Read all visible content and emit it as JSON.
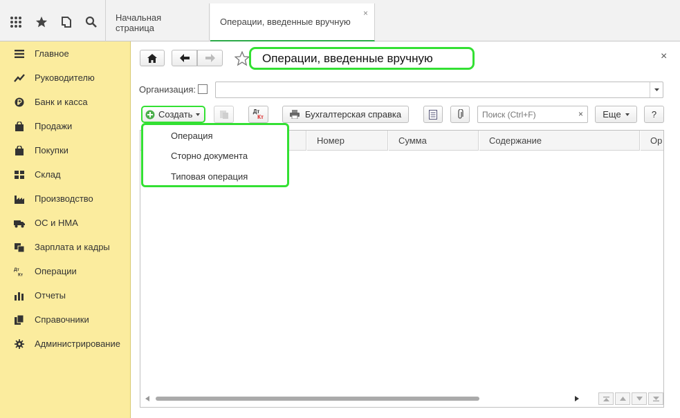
{
  "topbar": {
    "icons": [
      "apps-grid-icon",
      "star-icon",
      "history-icon",
      "search-icon"
    ],
    "tabs": [
      {
        "label": "Начальная страница",
        "active": false
      },
      {
        "label": "Операции, введенные вручную",
        "active": true,
        "close": "×"
      }
    ]
  },
  "sidebar": {
    "items": [
      {
        "label": "Главное",
        "icon": "menu-icon"
      },
      {
        "label": "Руководителю",
        "icon": "trend-icon"
      },
      {
        "label": "Банк и касса",
        "icon": "ruble-icon"
      },
      {
        "label": "Продажи",
        "icon": "bag-icon"
      },
      {
        "label": "Покупки",
        "icon": "cart-icon"
      },
      {
        "label": "Склад",
        "icon": "warehouse-icon"
      },
      {
        "label": "Производство",
        "icon": "factory-icon"
      },
      {
        "label": "ОС и НМА",
        "icon": "truck-icon"
      },
      {
        "label": "Зарплата и кадры",
        "icon": "people-icon"
      },
      {
        "label": "Операции",
        "icon": "dt-kt-icon"
      },
      {
        "label": "Отчеты",
        "icon": "bar-chart-icon"
      },
      {
        "label": "Справочники",
        "icon": "books-icon"
      },
      {
        "label": "Администрирование",
        "icon": "gear-icon"
      }
    ]
  },
  "form": {
    "title": "Операции, введенные вручную",
    "close": "×",
    "org_label": "Организация:",
    "org_value": "",
    "create_label": "Создать",
    "dtkt_top": "Дт",
    "dtkt_bottom": "Кт",
    "report_label": "Бухгалтерская справка",
    "search_placeholder": "Поиск (Ctrl+F)",
    "search_clear": "×",
    "more_label": "Еще",
    "help_label": "?",
    "columns": [
      "Номер",
      "Сумма",
      "Содержание",
      "Ор"
    ],
    "create_menu": [
      "Операция",
      "Сторно документа",
      "Типовая операция"
    ]
  },
  "colors": {
    "sidebar_bg": "#fbec9e",
    "highlight": "#33e033",
    "accent_tab": "#2aaa48"
  }
}
